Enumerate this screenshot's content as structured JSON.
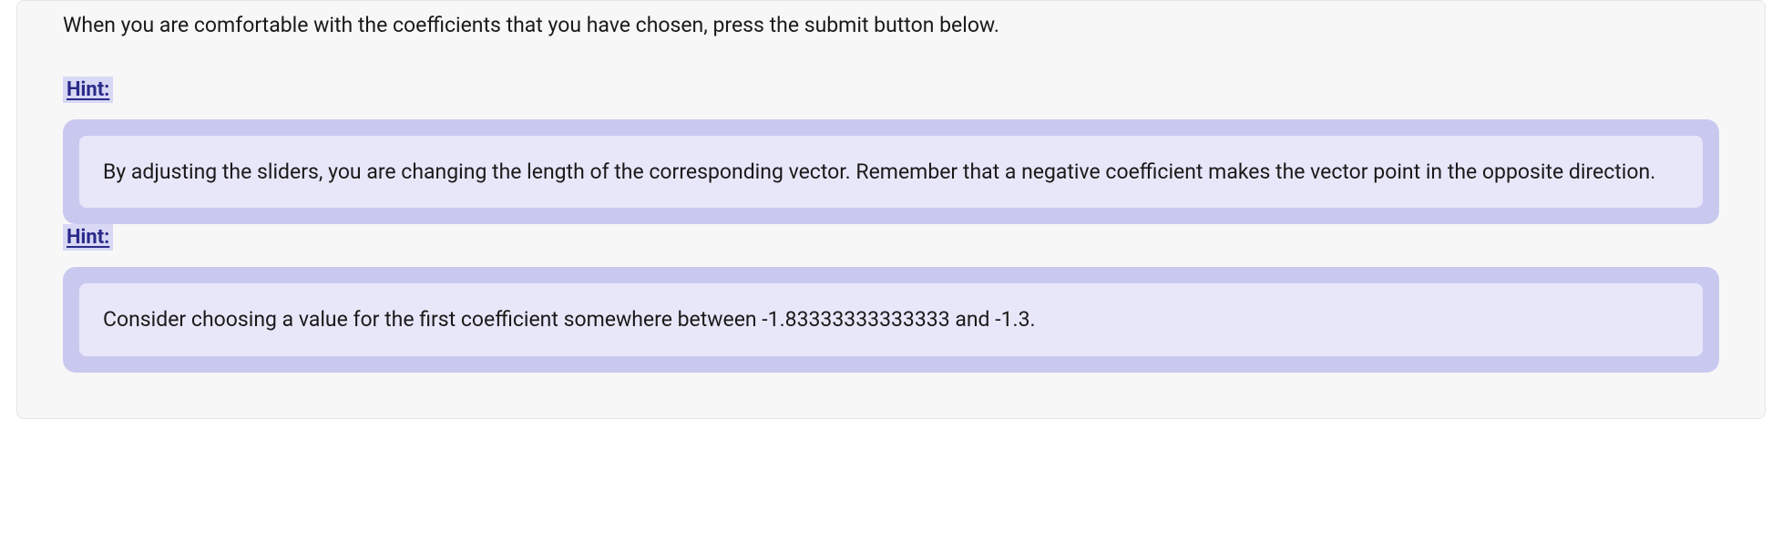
{
  "intro": "When you are comfortable with the coefficients that you have chosen, press the submit button below.",
  "hints": [
    {
      "label": "Hint:",
      "text": "By adjusting the sliders, you are changing the length of the corresponding vector. Remember that a negative coefficient makes the vector point in the opposite direction."
    },
    {
      "label": "Hint:",
      "text": "Consider choosing a value for the first coefficient somewhere between -1.83333333333333 and -1.3."
    }
  ]
}
